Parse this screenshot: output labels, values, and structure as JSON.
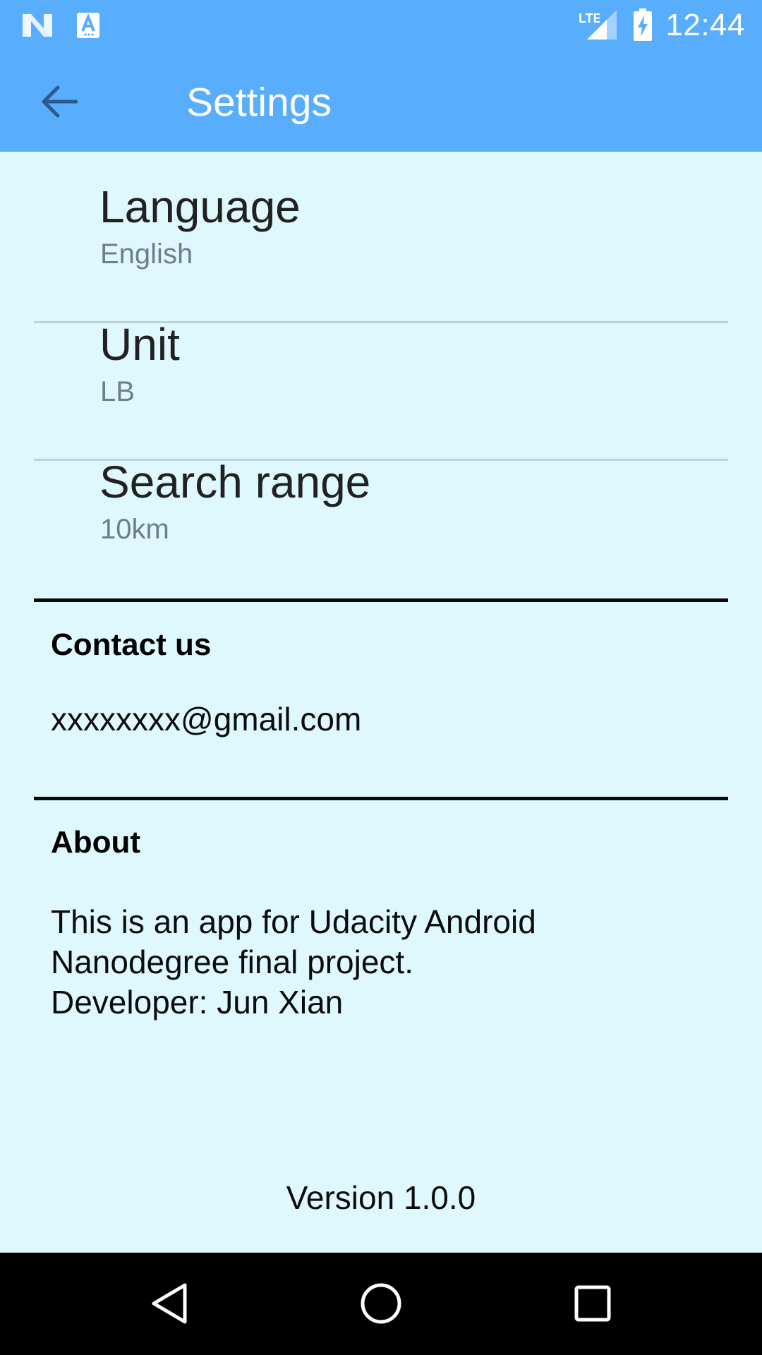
{
  "status_bar": {
    "time": "12:44",
    "left_icons": [
      "n-notification-icon",
      "a-notification-icon"
    ],
    "right_icons": [
      "lte-icon",
      "signal-icon",
      "battery-charging-icon"
    ]
  },
  "app_bar": {
    "title": "Settings",
    "back_icon": "arrow-back-icon",
    "background": "#58adfd"
  },
  "preferences": [
    {
      "title": "Language",
      "summary": "English"
    },
    {
      "title": "Unit",
      "summary": "LB"
    },
    {
      "title": "Search range",
      "summary": "10km"
    }
  ],
  "contact": {
    "heading": "Contact us",
    "email": "xxxxxxxx@gmail.com"
  },
  "about": {
    "heading": "About",
    "text": "This is an app for Udacity Android\nNanodegree final project.\nDeveloper: Jun Xian"
  },
  "version": "Version 1.0.0",
  "nav_bar": {
    "buttons": [
      "back-nav-icon",
      "home-nav-icon",
      "recents-nav-icon"
    ]
  },
  "colors": {
    "content_background": "#dff8fd",
    "accent": "#58adfd"
  }
}
